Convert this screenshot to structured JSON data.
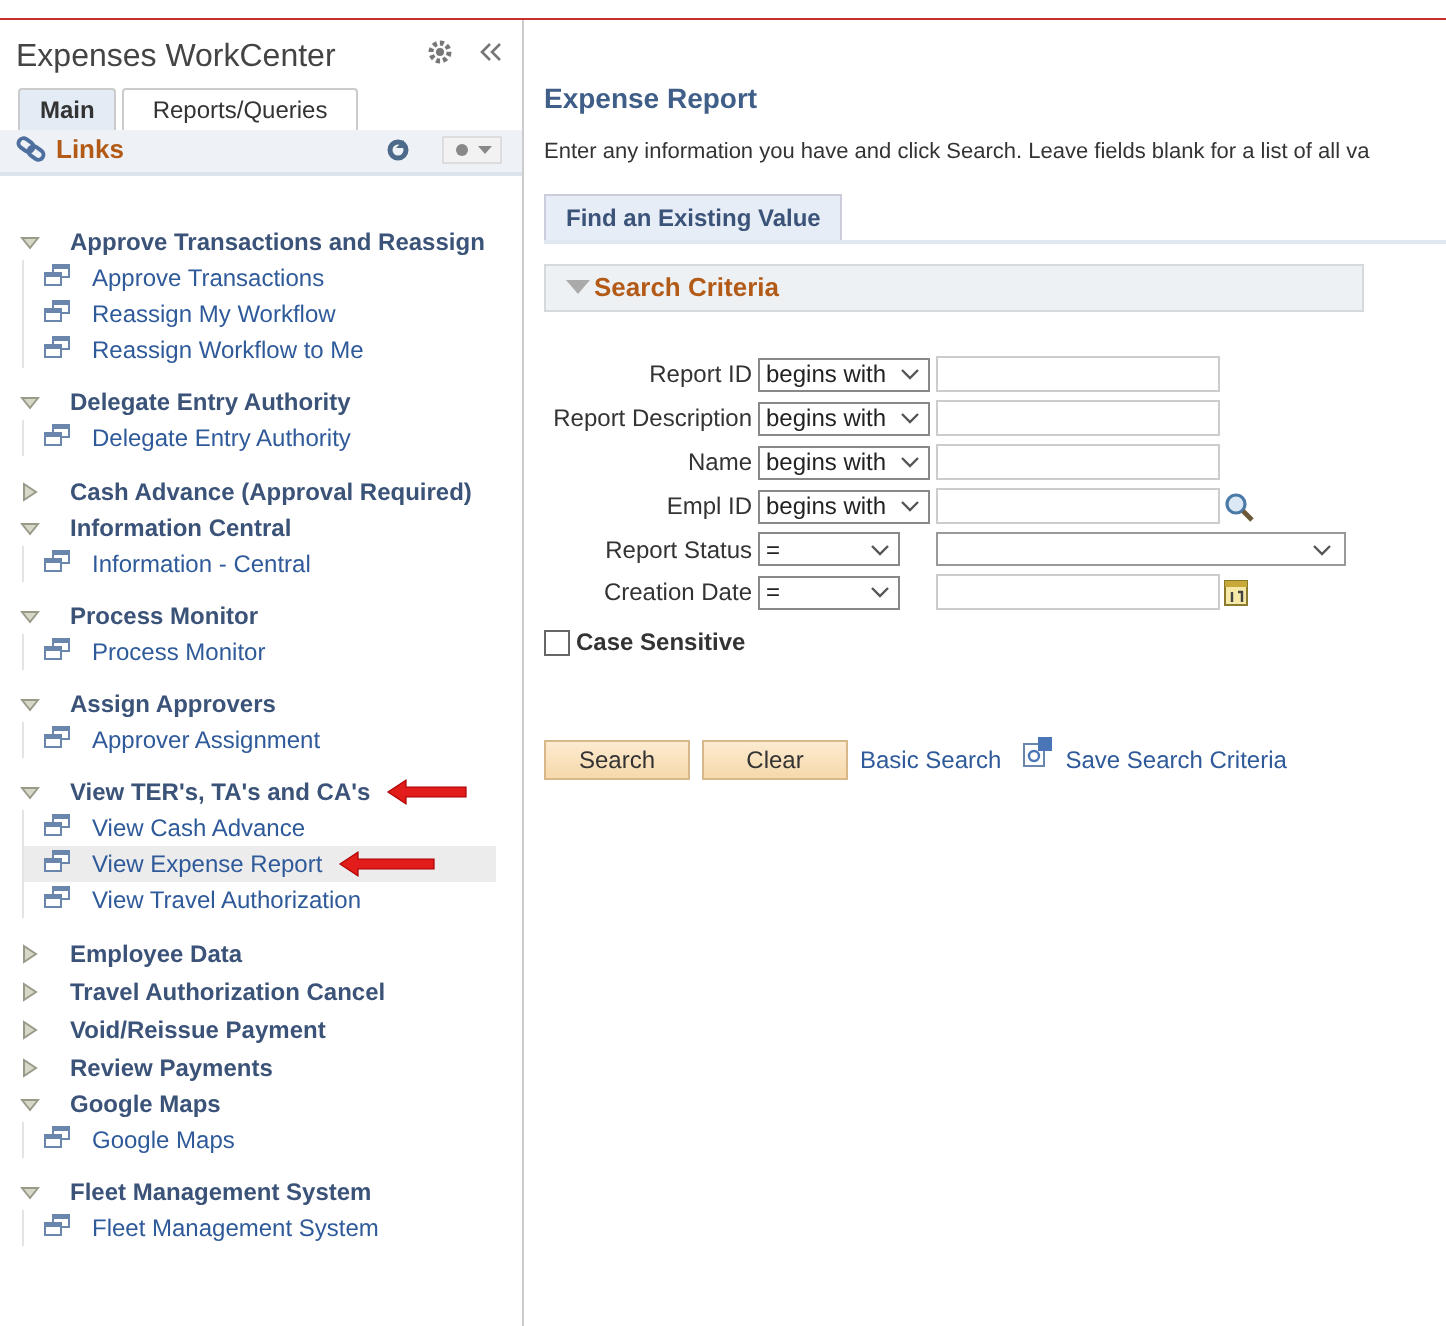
{
  "sidebar": {
    "title": "Expenses WorkCenter",
    "tabs": [
      {
        "label": "Main",
        "selected": true
      },
      {
        "label": "Reports/Queries",
        "selected": false
      }
    ],
    "section_title": "Links",
    "groups": [
      {
        "label": "Approve Transactions and Reassign",
        "expanded": true,
        "arrow": false,
        "children": [
          {
            "label": "Approve Transactions",
            "selected": false,
            "arrow": false
          },
          {
            "label": "Reassign My Workflow",
            "selected": false,
            "arrow": false
          },
          {
            "label": "Reassign Workflow to Me",
            "selected": false,
            "arrow": false
          }
        ]
      },
      {
        "label": "Delegate Entry Authority",
        "expanded": true,
        "arrow": false,
        "children": [
          {
            "label": "Delegate Entry Authority",
            "selected": false,
            "arrow": false
          }
        ]
      },
      {
        "label": "Cash Advance (Approval Required)",
        "expanded": false,
        "arrow": false
      },
      {
        "label": "Information Central",
        "expanded": true,
        "arrow": false,
        "children": [
          {
            "label": "Information - Central",
            "selected": false,
            "arrow": false
          }
        ]
      },
      {
        "label": "Process Monitor",
        "expanded": true,
        "arrow": false,
        "children": [
          {
            "label": "Process Monitor",
            "selected": false,
            "arrow": false
          }
        ]
      },
      {
        "label": "Assign Approvers",
        "expanded": true,
        "arrow": false,
        "children": [
          {
            "label": "Approver Assignment",
            "selected": false,
            "arrow": false
          }
        ]
      },
      {
        "label": "View TER's, TA's and CA's",
        "expanded": true,
        "arrow": true,
        "children": [
          {
            "label": "View Cash Advance",
            "selected": false,
            "arrow": false
          },
          {
            "label": "View Expense Report",
            "selected": true,
            "arrow": true
          },
          {
            "label": "View Travel Authorization",
            "selected": false,
            "arrow": false
          }
        ]
      },
      {
        "label": "Employee Data",
        "expanded": false,
        "arrow": false
      },
      {
        "label": "Travel Authorization Cancel",
        "expanded": false,
        "arrow": false
      },
      {
        "label": "Void/Reissue Payment",
        "expanded": false,
        "arrow": false
      },
      {
        "label": "Review Payments",
        "expanded": false,
        "arrow": false
      },
      {
        "label": "Google Maps",
        "expanded": true,
        "arrow": false,
        "children": [
          {
            "label": "Google Maps",
            "selected": false,
            "arrow": false
          }
        ]
      },
      {
        "label": "Fleet Management System",
        "expanded": true,
        "arrow": false,
        "children": [
          {
            "label": "Fleet Management System",
            "selected": false,
            "arrow": false
          }
        ]
      }
    ]
  },
  "page": {
    "title": "Expense Report",
    "instructions": "Enter any information you have and click Search. Leave fields blank for a list of all va",
    "tab": "Find an Existing Value",
    "section": {
      "title": "Search Criteria",
      "expanded": true
    },
    "fields": [
      {
        "label": "Report ID",
        "operator": "begins with",
        "kind": "text"
      },
      {
        "label": "Report Description",
        "operator": "begins with",
        "kind": "text"
      },
      {
        "label": "Name",
        "operator": "begins with",
        "kind": "text"
      },
      {
        "label": "Empl ID",
        "operator": "begins with",
        "kind": "lookup"
      },
      {
        "label": "Report Status",
        "operator": "=",
        "kind": "dropdown"
      },
      {
        "label": "Creation Date",
        "operator": "=",
        "kind": "date"
      }
    ],
    "case_sensitive": {
      "label": "Case Sensitive",
      "checked": false
    },
    "buttons": [
      "Search",
      "Clear"
    ],
    "links": [
      {
        "label": "Basic Search",
        "kind": "plain"
      },
      {
        "label": "Save Search Criteria",
        "kind": "save"
      }
    ]
  }
}
